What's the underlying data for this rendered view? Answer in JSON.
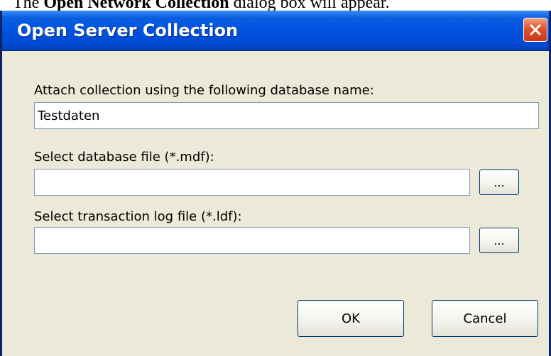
{
  "caption": {
    "prefix": "The ",
    "bold": "Open Network Collection",
    "suffix": " dialog box will appear."
  },
  "dialog": {
    "title": "Open Server Collection",
    "database_name_label": "Attach collection using the following database name:",
    "database_name_value": "Testdaten",
    "db_file_label": "Select database file (*.mdf):",
    "db_file_value": "",
    "browse_label": "...",
    "log_file_label": "Select transaction log file (*.ldf):",
    "log_file_value": "",
    "ok_label": "OK",
    "cancel_label": "Cancel"
  },
  "colors": {
    "titlebar": "#0053e0",
    "window_face": "#ece9d8",
    "close_button": "#e0522e"
  }
}
